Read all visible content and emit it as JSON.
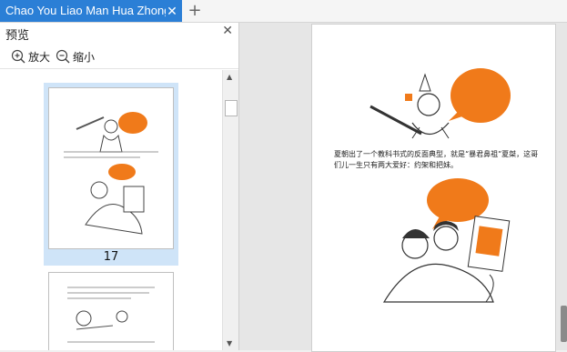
{
  "tab": {
    "title": "Chao You Liao Man Hua Zhong Guo Shi",
    "close_icon": "close-icon",
    "new_icon": "plus-icon"
  },
  "panel": {
    "title": "预览",
    "zoom_in_label": "放大",
    "zoom_out_label": "缩小"
  },
  "thumbnails": [
    {
      "page_number": "17",
      "selected": true
    },
    {
      "page_number": "",
      "selected": false
    }
  ],
  "document": {
    "paragraph": "夏朝出了一个教科书式的反面典型，就是“暴君鼻祖”夏桀，这哥们儿一生只有两大爱好：约架和把妹。"
  },
  "colors": {
    "tab_active": "#2b7fd6",
    "thumb_selected": "#cfe4f8",
    "bubble": "#f07a1a"
  }
}
